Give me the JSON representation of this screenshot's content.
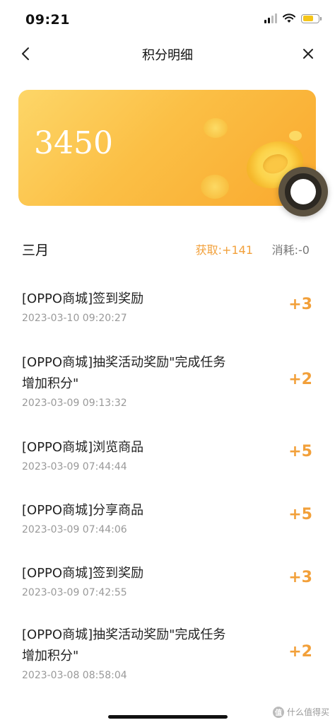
{
  "status_bar": {
    "time": "09:21"
  },
  "nav": {
    "title": "积分明细"
  },
  "points": {
    "value": "3450"
  },
  "summary": {
    "month": "三月",
    "earned": "获取:+141",
    "spent": "消耗:-0"
  },
  "records": [
    {
      "title": "[OPPO商城]签到奖励",
      "time": "2023-03-10 09:20:27",
      "delta": "+3"
    },
    {
      "title": "[OPPO商城]抽奖活动奖励\"完成任务增加积分\"",
      "time": "2023-03-09 09:13:32",
      "delta": "+2"
    },
    {
      "title": "[OPPO商城]浏览商品",
      "time": "2023-03-09 07:44:44",
      "delta": "+5"
    },
    {
      "title": "[OPPO商城]分享商品",
      "time": "2023-03-09 07:44:06",
      "delta": "+5"
    },
    {
      "title": "[OPPO商城]签到奖励",
      "time": "2023-03-09 07:42:55",
      "delta": "+3"
    },
    {
      "title": "[OPPO商城]抽奖活动奖励\"完成任务增加积分\"",
      "time": "2023-03-08 08:58:04",
      "delta": "+2"
    }
  ],
  "watermark": {
    "text": "什么值得买",
    "logo": "值"
  },
  "colors": {
    "accent": "#f2a03a",
    "card_start": "#fdd668",
    "card_end": "#f9a92e"
  }
}
